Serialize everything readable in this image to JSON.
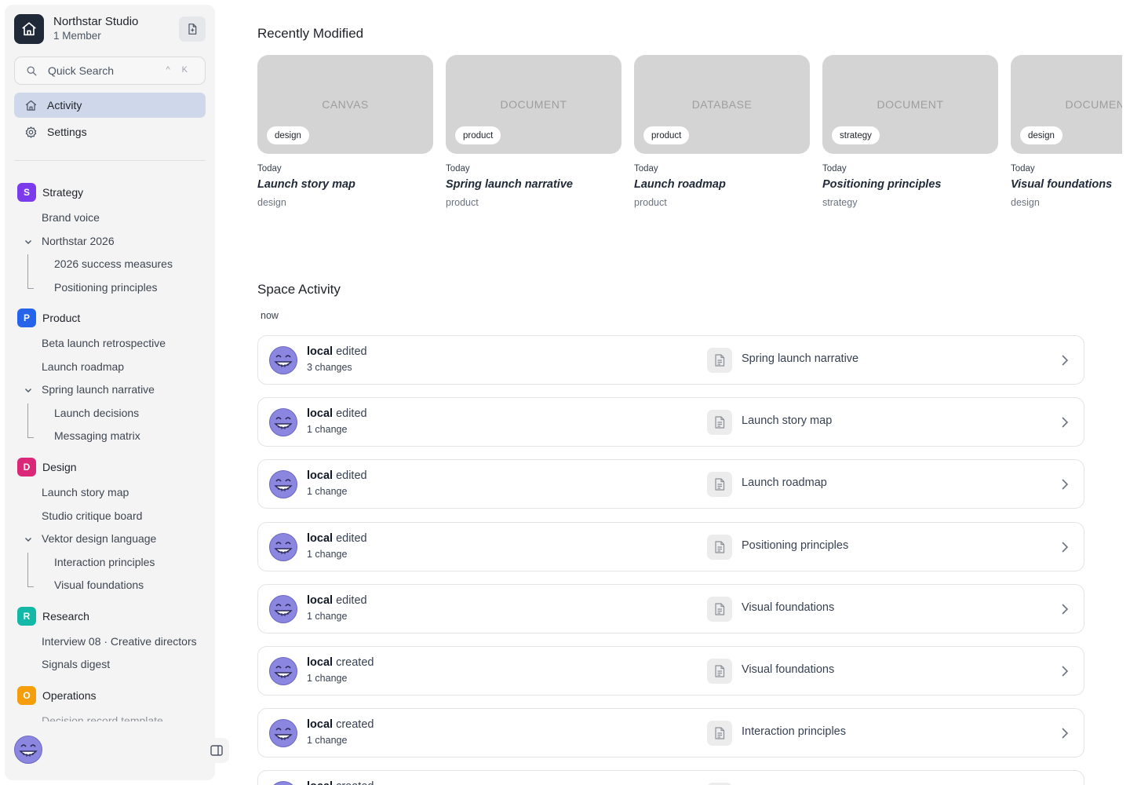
{
  "workspace": {
    "name": "Northstar Studio",
    "members": "1 Member",
    "logo_icon": "home-icon",
    "new_doc_icon": "file-plus-icon"
  },
  "search": {
    "label": "Quick Search",
    "shortcut": "^ K"
  },
  "nav": [
    {
      "label": "Activity",
      "icon": "activity-icon",
      "active": true
    },
    {
      "label": "Settings",
      "icon": "gear-icon",
      "active": false
    }
  ],
  "spaces": [
    {
      "badge": "S",
      "name": "Strategy",
      "color": "#7c3aed",
      "items": [
        "Brand voice",
        "Northstar 2026",
        "2026 success measures",
        "Positioning principles"
      ]
    },
    {
      "badge": "P",
      "name": "Product",
      "color": "#2563eb",
      "items": [
        "Beta launch retrospective",
        "Launch roadmap",
        "Spring launch narrative",
        "Launch decisions",
        "Messaging matrix"
      ]
    },
    {
      "badge": "D",
      "name": "Design",
      "color": "#db2777",
      "items": [
        "Launch story map",
        "Studio critique board",
        "Vektor design language",
        "Interaction principles",
        "Visual foundations"
      ]
    },
    {
      "badge": "R",
      "name": "Research",
      "color": "#14b8a6",
      "items": [
        "Interview 08 · Creative directors",
        "Signals digest"
      ]
    },
    {
      "badge": "O",
      "name": "Operations",
      "color": "#f59e0b",
      "items": [
        "Decision record template"
      ]
    }
  ],
  "recent": {
    "title": "Recently Modified",
    "cards": [
      {
        "type": "CANVAS",
        "tag": "design",
        "date": "Today",
        "title": "Launch story map",
        "space": "design"
      },
      {
        "type": "DOCUMENT",
        "tag": "product",
        "date": "Today",
        "title": "Spring launch narrative",
        "space": "product"
      },
      {
        "type": "DATABASE",
        "tag": "product",
        "date": "Today",
        "title": "Launch roadmap",
        "space": "product"
      },
      {
        "type": "DOCUMENT",
        "tag": "strategy",
        "date": "Today",
        "title": "Positioning principles",
        "space": "strategy"
      },
      {
        "type": "DOCUMENT",
        "tag": "design",
        "date": "Today",
        "title": "Visual foundations",
        "space": "design"
      }
    ]
  },
  "activity": {
    "title": "Space Activity",
    "group_label": "now",
    "rows": [
      {
        "user": "local",
        "action": "edited",
        "changes": "3 changes",
        "doc": "Spring launch narrative"
      },
      {
        "user": "local",
        "action": "edited",
        "changes": "1 change",
        "doc": "Launch story map"
      },
      {
        "user": "local",
        "action": "edited",
        "changes": "1 change",
        "doc": "Launch roadmap"
      },
      {
        "user": "local",
        "action": "edited",
        "changes": "1 change",
        "doc": "Positioning principles"
      },
      {
        "user": "local",
        "action": "edited",
        "changes": "1 change",
        "doc": "Visual foundations"
      },
      {
        "user": "local",
        "action": "created",
        "changes": "1 change",
        "doc": "Visual foundations"
      },
      {
        "user": "local",
        "action": "created",
        "changes": "1 change",
        "doc": "Interaction principles"
      },
      {
        "user": "local",
        "action": "created",
        "changes": "",
        "doc": ""
      }
    ]
  }
}
